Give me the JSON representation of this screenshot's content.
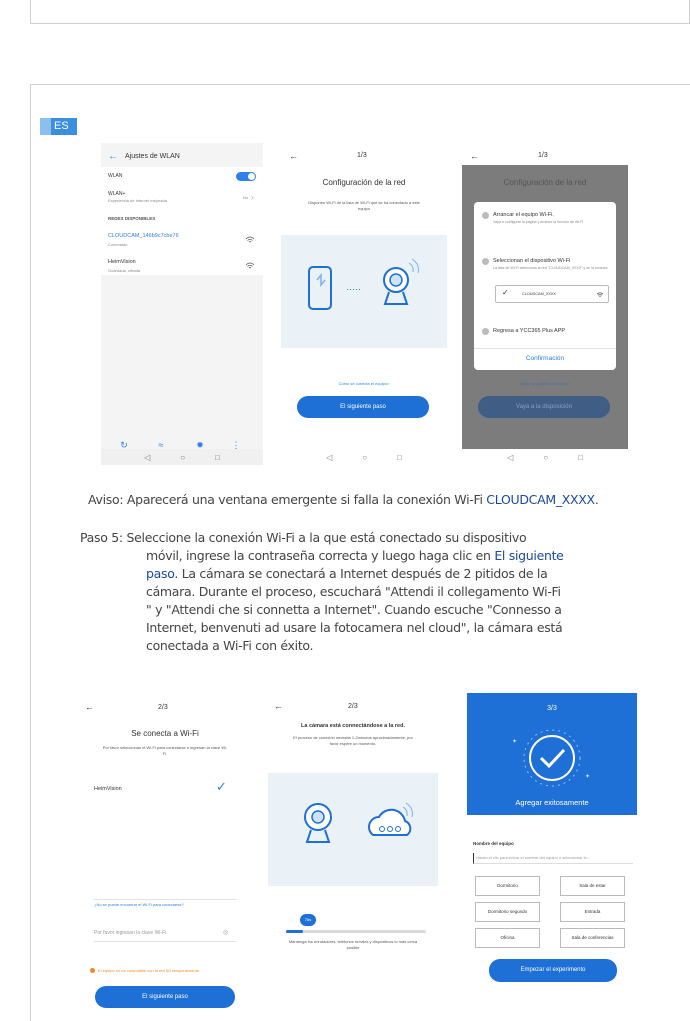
{
  "lang_badge": "ES",
  "screen1": {
    "back": "←",
    "title": "Ajustes de WLAN",
    "wlan_label": "WLAN",
    "wlan_plus_label": "WLAN+",
    "wlan_plus_sub": "Experiencia de Internet mejorada",
    "wlan_plus_value": "No",
    "section": "REDES DISPONIBLES",
    "networks": [
      {
        "name": "CLOUDCAM_146b9c7cbe76",
        "status": "Conectado"
      },
      {
        "name": "HeimVision",
        "status": "Guardada ,cifrada"
      }
    ],
    "bottom_items": [
      "Buscar",
      "Wi-Fi Directo",
      "Ajustes",
      "Más"
    ]
  },
  "screen2": {
    "back": "←",
    "step": "1/3",
    "title": "Configuración de la red",
    "desc": "Disponen Wi-Fi de la lista de Wi-Fi que se ha conectado a este equipo",
    "link": "Cómo se conecta el equipo>",
    "button": "El siguiente paso"
  },
  "screen3": {
    "back": "←",
    "step": "1/3",
    "title": "Configuración de la red",
    "opt1_title": "Arrancar el equipo Wi-Fi.",
    "opt1_desc": "Vaya a configurar la página y arrance la función de Wi-Fi",
    "opt2_title": "Seleccionan el dispositivo Wi-Fi",
    "opt2_desc": "La lista de Wi-Fi selecciona la red \"CLOUDCAM_XXXX\" y se la conecta.",
    "opt2_net": "CLOUDCAM_XXXX",
    "opt3_title": "Regresa a YCC365 Plus APP",
    "confirm": "Confirmación",
    "behind_link": "Cómo se conecta el equipo>",
    "behind_button": "Vaya a la disposición"
  },
  "caption": {
    "prefix": "Aviso: Aparecerá una ventana emergente si falla la conexión Wi-Fi ",
    "highlight": "CLOUDCAM_XXXX",
    "suffix": "."
  },
  "paragraph": {
    "line1": "Paso 5: Seleccione la conexión Wi-Fi a la que está conectado su dispositivo",
    "line2_pre": "móvil, ingrese la contraseña correcta y luego haga clic en ",
    "line2_hl": "El siguiente",
    "line3_hl": "paso",
    "line3_post": ". La cámara se conectará a Internet después de 2 pitidos de la",
    "line4": "cámara. Durante el proceso, escuchará \"Attendi il collegamento Wi-Fi",
    "line5": "\" y \"Attendi che si connetta a Internet\". Cuando escuche \"Connesso a",
    "line6": "Internet, benvenuti ad usare la fotocamera nel cloud\", la cámara está",
    "line7": "conectada a Wi-Fi con éxito."
  },
  "screen4": {
    "back": "←",
    "step": "2/3",
    "title": "Se conecta a Wi-Fi",
    "desc": "Por favor seleccionan el Wi-Fi para conectarse e ingresan la clave Wi-Fi.",
    "network": "HeimVision",
    "cant_find": "¿No se puede encontrar el Wi-Fi para conectarse?",
    "password_placeholder": "Por favor ingresan la clave Wi-Fi.",
    "warning": "El equipo no es compatible con la red 5G temporalmente",
    "button": "El siguiente paso"
  },
  "screen5": {
    "back": "←",
    "step": "2/3",
    "title": "La cámara está connectándose a la red.",
    "desc": "El proceso de conexión necesita 1-2minutos aproximadamente, por favor espere un momento.",
    "progress_label": "76s",
    "progress": 0.12,
    "note": "Mantenga los enrutadores, teléfonos móviles y dispositivos lo más cerca posible"
  },
  "screen6": {
    "step": "3/3",
    "success": "Agregar exitosamente",
    "name_label": "Nombre del equipo",
    "name_placeholder": "Hacen el clic para entrar el nombre del equipo o seleccionar lo...",
    "rooms": [
      "Dormitorio",
      "Sala de estar",
      "Dormitorio segundo",
      "Entrada",
      "Oficina",
      "Sala de conferencias"
    ],
    "button": "Empezar el experimento"
  },
  "colors": {
    "accent": "#1e6fd6",
    "toggle": "#2f80ed",
    "warning": "#f08a24",
    "caption_highlight": "#1a4aa0"
  }
}
